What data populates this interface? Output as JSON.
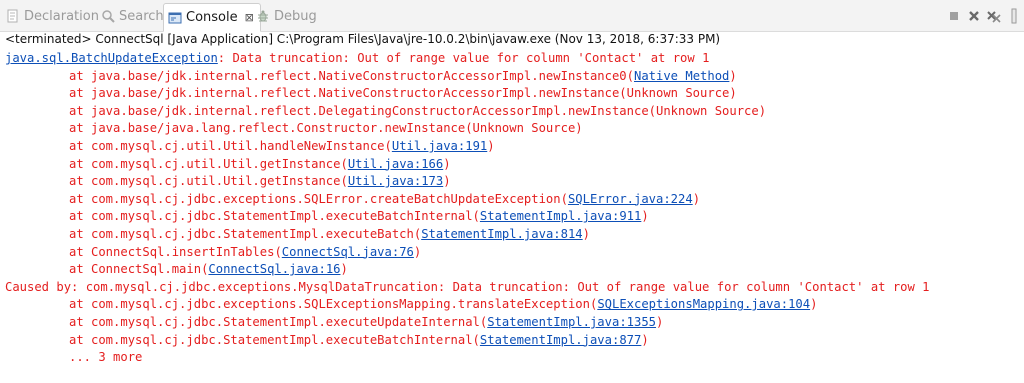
{
  "tabs": [
    {
      "label": "Declaration",
      "icon": "declaration-icon",
      "active": false
    },
    {
      "label": "Search",
      "icon": "search-icon",
      "active": false
    },
    {
      "label": "Console",
      "icon": "console-icon",
      "active": true,
      "close": "⊠"
    },
    {
      "label": "Debug",
      "icon": "debug-icon",
      "active": false
    }
  ],
  "toolbar": {
    "items": [
      "terminate-icon",
      "remove-launch-icon",
      "remove-all-terminated-icon",
      "scroll-lock-icon"
    ]
  },
  "status": "<terminated> ConnectSql [Java Application] C:\\Program Files\\Java\\jre-10.0.2\\bin\\javaw.exe (Nov 13, 2018, 6:37:33 PM)",
  "colors": {
    "error": "#e41e1e",
    "link": "#0d4fb7"
  },
  "console_lines": [
    {
      "indent": "",
      "pre": "",
      "link": "java.sql.BatchUpdateException",
      "post": ": Data truncation: Out of range value for column 'Contact' at row 1"
    },
    {
      "indent": "\t",
      "pre": "at java.base/jdk.internal.reflect.NativeConstructorAccessorImpl.newInstance0(",
      "link": "Native Method",
      "post": ")"
    },
    {
      "indent": "\t",
      "pre": "at java.base/jdk.internal.reflect.NativeConstructorAccessorImpl.newInstance(Unknown Source)",
      "link": "",
      "post": ""
    },
    {
      "indent": "\t",
      "pre": "at java.base/jdk.internal.reflect.DelegatingConstructorAccessorImpl.newInstance(Unknown Source)",
      "link": "",
      "post": ""
    },
    {
      "indent": "\t",
      "pre": "at java.base/java.lang.reflect.Constructor.newInstance(Unknown Source)",
      "link": "",
      "post": ""
    },
    {
      "indent": "\t",
      "pre": "at com.mysql.cj.util.Util.handleNewInstance(",
      "link": "Util.java:191",
      "post": ")"
    },
    {
      "indent": "\t",
      "pre": "at com.mysql.cj.util.Util.getInstance(",
      "link": "Util.java:166",
      "post": ")"
    },
    {
      "indent": "\t",
      "pre": "at com.mysql.cj.util.Util.getInstance(",
      "link": "Util.java:173",
      "post": ")"
    },
    {
      "indent": "\t",
      "pre": "at com.mysql.cj.jdbc.exceptions.SQLError.createBatchUpdateException(",
      "link": "SQLError.java:224",
      "post": ")"
    },
    {
      "indent": "\t",
      "pre": "at com.mysql.cj.jdbc.StatementImpl.executeBatchInternal(",
      "link": "StatementImpl.java:911",
      "post": ")"
    },
    {
      "indent": "\t",
      "pre": "at com.mysql.cj.jdbc.StatementImpl.executeBatch(",
      "link": "StatementImpl.java:814",
      "post": ")"
    },
    {
      "indent": "\t",
      "pre": "at ConnectSql.insertInTables(",
      "link": "ConnectSql.java:76",
      "post": ")"
    },
    {
      "indent": "\t",
      "pre": "at ConnectSql.main(",
      "link": "ConnectSql.java:16",
      "post": ")"
    },
    {
      "indent": "",
      "pre": "Caused by: com.mysql.cj.jdbc.exceptions.MysqlDataTruncation: Data truncation: Out of range value for column 'Contact' at row 1",
      "link": "",
      "post": ""
    },
    {
      "indent": "\t",
      "pre": "at com.mysql.cj.jdbc.exceptions.SQLExceptionsMapping.translateException(",
      "link": "SQLExceptionsMapping.java:104",
      "post": ")"
    },
    {
      "indent": "\t",
      "pre": "at com.mysql.cj.jdbc.StatementImpl.executeUpdateInternal(",
      "link": "StatementImpl.java:1355",
      "post": ")"
    },
    {
      "indent": "\t",
      "pre": "at com.mysql.cj.jdbc.StatementImpl.executeBatchInternal(",
      "link": "StatementImpl.java:877",
      "post": ")"
    },
    {
      "indent": "\t",
      "pre": "... 3 more",
      "link": "",
      "post": ""
    }
  ]
}
